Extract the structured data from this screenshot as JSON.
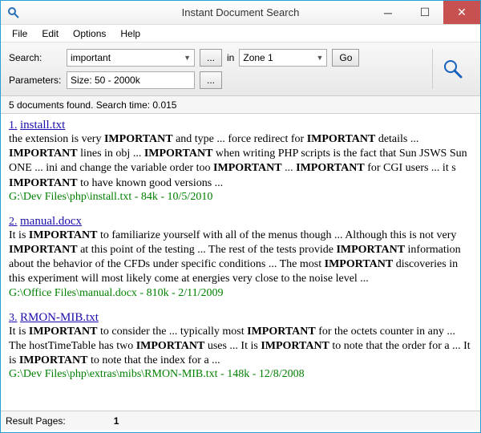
{
  "window": {
    "title": "Instant Document Search"
  },
  "menu": {
    "file": "File",
    "edit": "Edit",
    "options": "Options",
    "help": "Help"
  },
  "toolbar": {
    "search_label": "Search:",
    "search_value": "important",
    "browse": "...",
    "in_label": "in",
    "zone": "Zone 1",
    "go": "Go",
    "params_label": "Parameters:",
    "params_value": "Size: 50 - 2000k",
    "params_browse": "..."
  },
  "status": {
    "text": "5 documents found. Search time: 0.015"
  },
  "results": [
    {
      "num": "1.",
      "title": "install.txt",
      "snippet_html": "the extension is very <b>IMPORTANT</b> and type ... force redirect for <b>IMPORTANT</b> details ... <b>IMPORTANT</b> lines in obj ... <b>IMPORTANT</b> when writing PHP scripts is the fact that Sun JSWS Sun ONE ... ini and change the variable order too <b>IMPORTANT</b> ... <b>IMPORTANT</b> for CGI users ... it s <b>IMPORTANT</b> to have known good versions ...",
      "meta": "G:\\Dev Files\\php\\install.txt - 84k - 10/5/2010"
    },
    {
      "num": "2.",
      "title": "manual.docx",
      "snippet_html": "It is <b>IMPORTANT</b> to familiarize yourself with all of the menus though ... Although this is not very <b>IMPORTANT</b> at this point of the testing ... The rest of the tests provide <b>IMPORTANT</b> information about the behavior of the CFDs under specific conditions ... The most <b>IMPORTANT</b> discoveries in this experiment will most likely come at energies very close to the noise level ...",
      "meta": "G:\\Office Files\\manual.docx - 810k - 2/11/2009"
    },
    {
      "num": "3.",
      "title": "RMON-MIB.txt",
      "snippet_html": "It is <b>IMPORTANT</b> to consider the ... typically most <b>IMPORTANT</b> for the octets counter in any ... The hostTimeTable has two <b>IMPORTANT</b> uses ... It is <b>IMPORTANT</b> to note that the order for a ... It is <b>IMPORTANT</b> to note that the index for a ...",
      "meta": "G:\\Dev Files\\php\\extras\\mibs\\RMON-MIB.txt - 148k - 12/8/2008"
    }
  ],
  "footer": {
    "pages_label": "Result Pages:",
    "current_page": "1"
  }
}
